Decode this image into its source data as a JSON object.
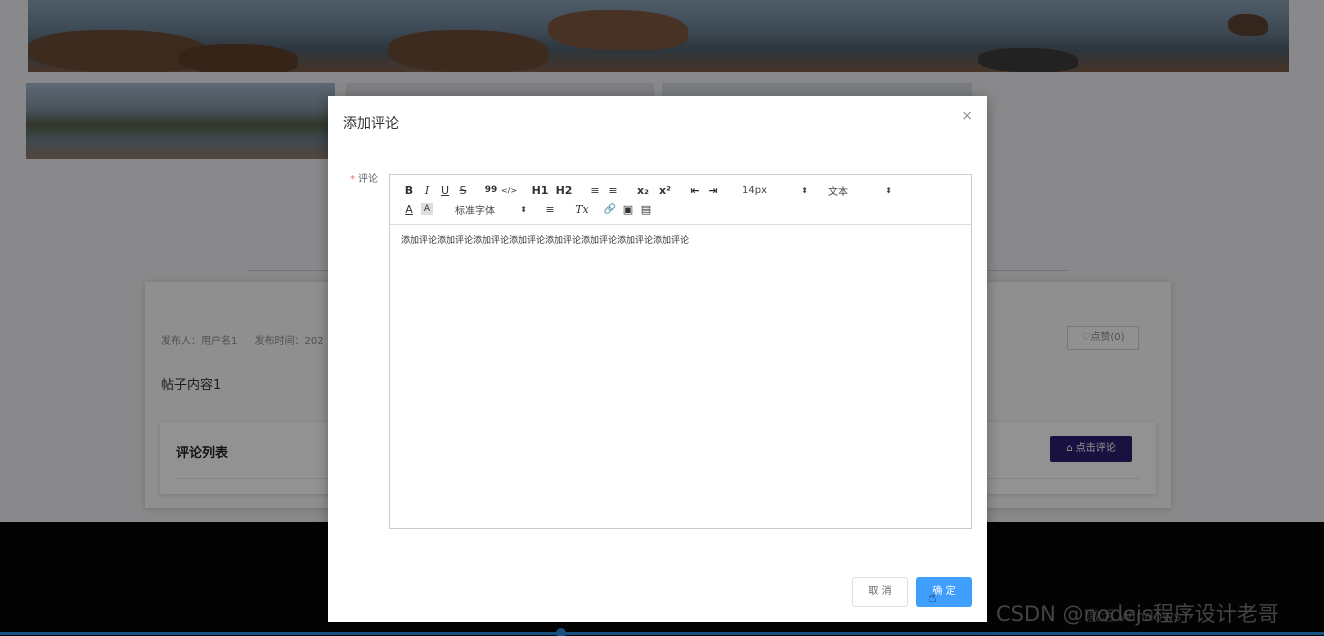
{
  "background": {
    "post_author_label": "发布人：用户名1",
    "post_time_label": "发布时间：202",
    "like_button": "点赞(0)",
    "post_content": "帖子内容1",
    "comment_list_title": "评论列表",
    "comment_button": "点击评论",
    "windows_note": "激活 Windows"
  },
  "dialog": {
    "title": "添加评论",
    "close_icon": "×",
    "field_label": "评论",
    "required_mark": "*",
    "toolbar": {
      "bold": "B",
      "italic": "I",
      "underline": "U",
      "strike": "S",
      "blockquote": "99",
      "code": "</>",
      "h1": "H1",
      "h2": "H2",
      "ordered_list": "≡",
      "bullet_list": "≡",
      "subscript": "x₂",
      "superscript": "x²",
      "outdent": "⇤",
      "indent": "⇥",
      "font_size": "14px",
      "header_select": "文本",
      "text_color": "A",
      "background_color": "A",
      "font_family": "标准字体",
      "align": "≡",
      "clean": "Tx",
      "link": "🔗",
      "image": "▣",
      "video": "▤"
    },
    "editor_content": "添加评论添加评论添加评论添加评论添加评论添加评论添加评论添加评论",
    "cancel_button": "取 消",
    "confirm_button": "确 定"
  },
  "watermark": "CSDN @nodejs程序设计老哥",
  "colors": {
    "primary": "#409eff",
    "dark_button": "#2c1f6e",
    "required": "#f56c6c"
  }
}
